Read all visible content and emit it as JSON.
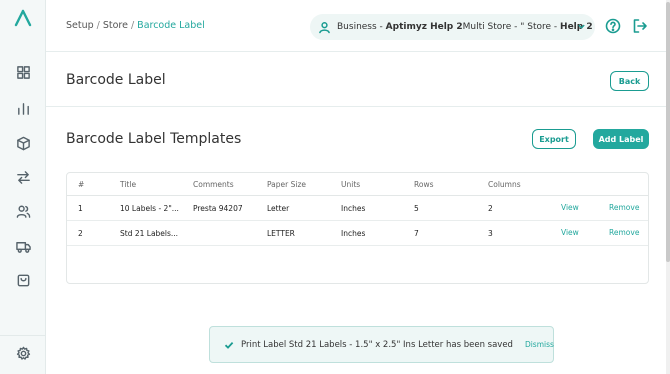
{
  "app": {
    "logo_icon": "app-logo-icon",
    "accent_color": "#23a89e"
  },
  "sidebar": {
    "items": [
      {
        "name": "dashboard",
        "icon": "grid-icon"
      },
      {
        "name": "reports",
        "icon": "bar-chart-icon"
      },
      {
        "name": "products",
        "icon": "box-icon"
      },
      {
        "name": "transfers",
        "icon": "arrows-icon"
      },
      {
        "name": "customers",
        "icon": "users-icon"
      },
      {
        "name": "shipping",
        "icon": "truck-icon"
      },
      {
        "name": "orders",
        "icon": "shopping-bag-icon"
      },
      {
        "name": "settings",
        "icon": "gear-icon"
      }
    ]
  },
  "breadcrumb": {
    "item1": "Setup",
    "sep": "/",
    "item2": "Store",
    "current": "Barcode Label"
  },
  "business": {
    "prefix": "Business - ",
    "bold1": "Aptimyz Help 2",
    "middle": " Multi Store - \" Store - ",
    "bold2": "Help 2"
  },
  "header": {
    "title": "Barcode Label",
    "back_label": "Back"
  },
  "section": {
    "title": "Barcode Label Templates",
    "export_label": "Export",
    "add_label": "Add Label"
  },
  "table": {
    "columns": [
      "#",
      "Title",
      "Comments",
      "Paper Size",
      "Units",
      "Rows",
      "Columns"
    ],
    "rows": [
      {
        "num": "1",
        "title": "10 Labels - 2\"...",
        "comments": "Presta 94207",
        "paper_size": "Letter",
        "units": "Inches",
        "rows": "5",
        "columns": "2",
        "view": "View",
        "remove": "Remove"
      },
      {
        "num": "2",
        "title": "Std 21 Labels...",
        "comments": "",
        "paper_size": "LETTER",
        "units": "Inches",
        "rows": "7",
        "columns": "3",
        "view": "View",
        "remove": "Remove"
      }
    ]
  },
  "toast": {
    "message": "Print Label Std 21 Labels - 1.5\" x 2.5\" Ins Letter has been saved",
    "dismiss_label": "Dismiss"
  }
}
